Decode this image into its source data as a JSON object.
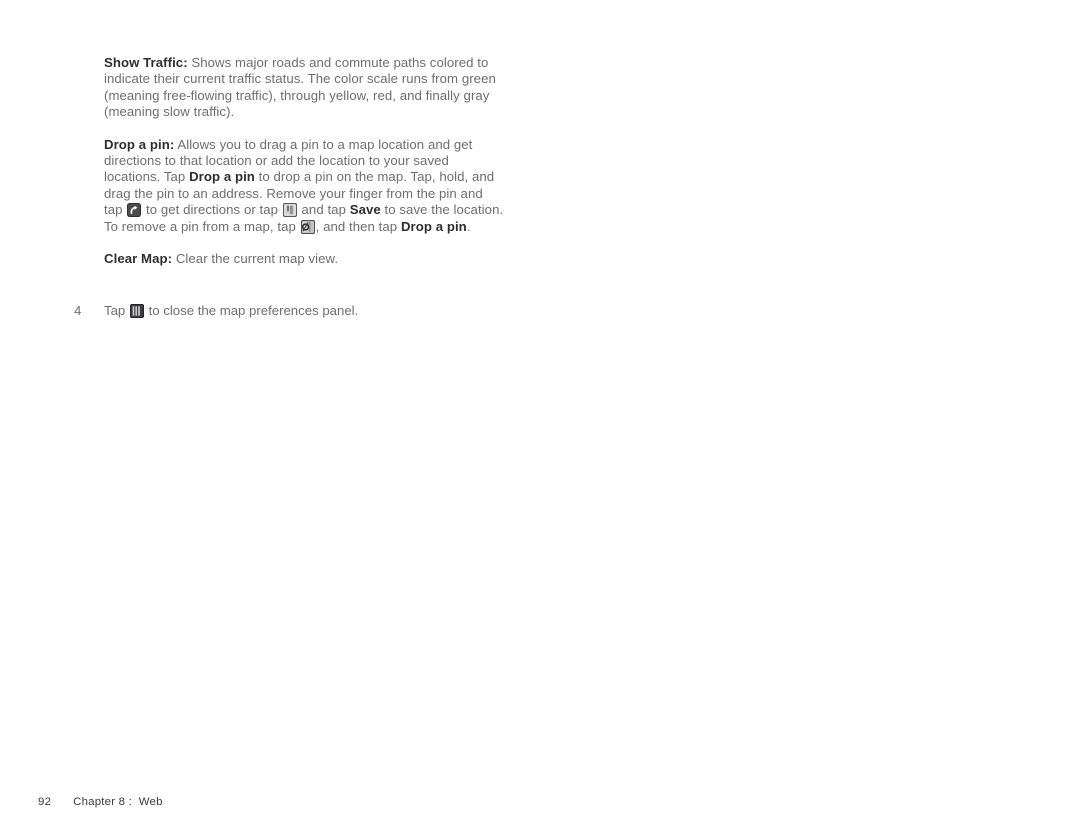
{
  "page": {
    "background": "#ffffff",
    "body_text_color": "#6d6e70",
    "bold_text_color": "#2f2f31"
  },
  "content": {
    "show_traffic": {
      "lead": "Show Traffic:",
      "body": " Shows major roads and commute paths colored to indicate their current traffic status. The color scale runs from green (meaning free-flowing traffic), through yellow, red, and finally gray (meaning slow traffic)."
    },
    "drop_a_pin": {
      "lead": "Drop a pin:",
      "part1": " Allows you to drag a pin to a map location and get directions to that location or add the location to your saved locations. Tap ",
      "bold1": "Drop a pin",
      "part2": " to drop a pin on the map. Tap, hold, and drag the pin to an address. Remove your finger from the pin and tap ",
      "icon1": "directions-icon",
      "part3": " to get directions or tap ",
      "icon2": "bookmark-icon",
      "part4": " and tap ",
      "bold2": "Save",
      "part5": " to save the location. To remove a pin from a map, tap ",
      "icon3": "remove-pin-icon",
      "part6": ", and then tap ",
      "bold3": "Drop a pin",
      "part7": "."
    },
    "clear_map": {
      "lead": "Clear Map:",
      "body": " Clear the current map view."
    }
  },
  "step": {
    "number": "4",
    "text_before": "Tap ",
    "icon": "close-panel-icon",
    "text_after": " to close the map preferences panel."
  },
  "footer": {
    "page_number": "92",
    "chapter": "Chapter 8 :  Web"
  }
}
